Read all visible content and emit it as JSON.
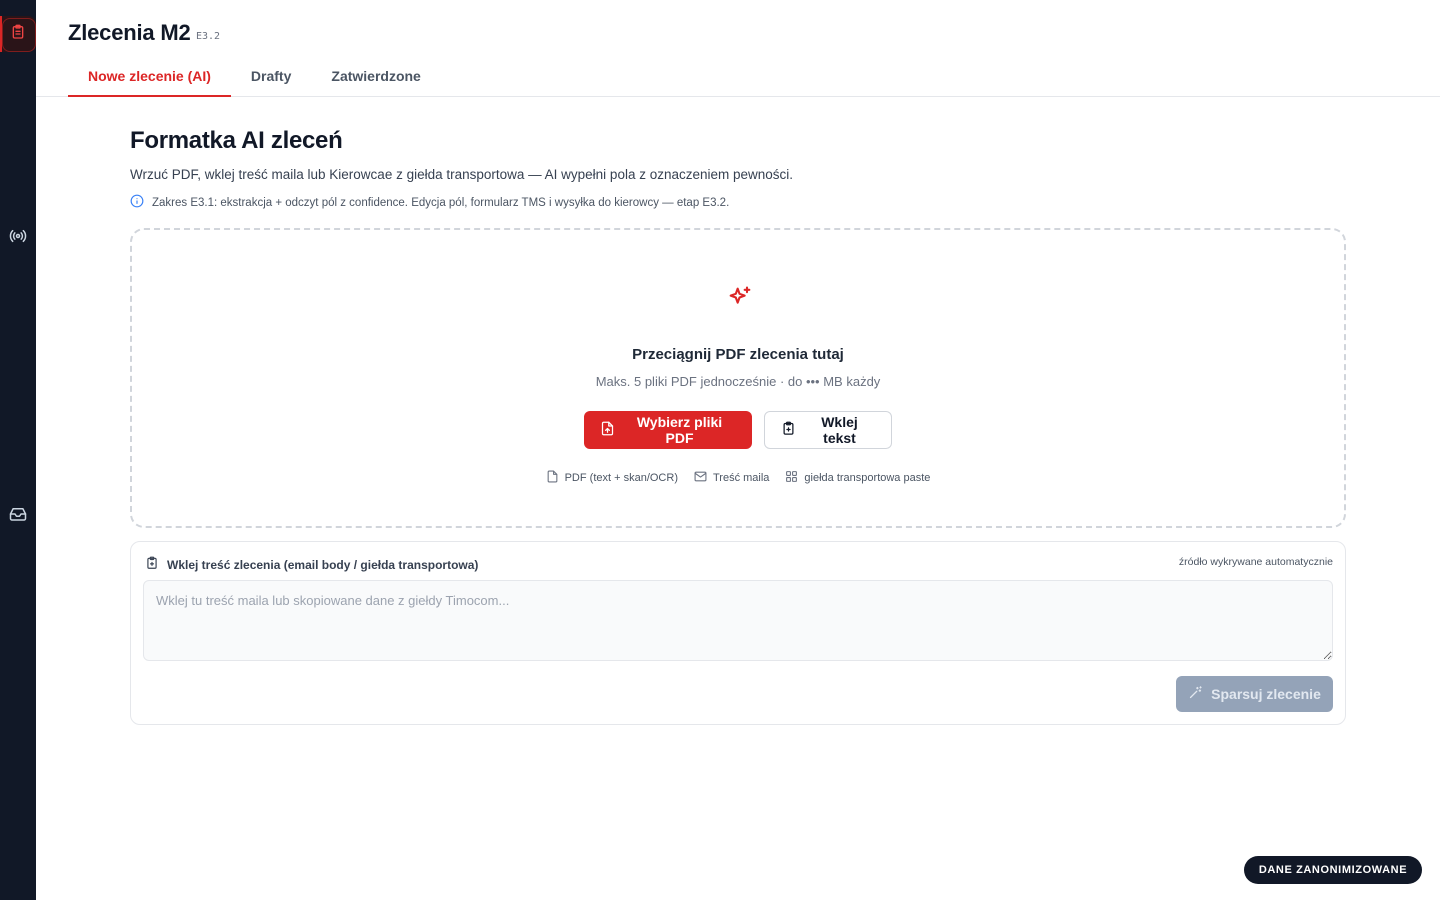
{
  "sidebar": {
    "items": [
      {
        "name": "orders",
        "icon": "clipboard-icon",
        "active": true
      },
      {
        "name": "radar",
        "icon": "radio-signal-icon",
        "active": false
      },
      {
        "name": "inbox",
        "icon": "inbox-icon",
        "active": false
      }
    ]
  },
  "header": {
    "title": "Zlecenia M2",
    "version": "E3.2",
    "tabs": [
      {
        "label": "Nowe zlecenie (AI)",
        "active": true
      },
      {
        "label": "Drafty",
        "active": false
      },
      {
        "label": "Zatwierdzone",
        "active": false
      }
    ]
  },
  "main": {
    "heading": "Formatka AI zleceń",
    "subtitle": "Wrzuć PDF, wklej treść maila lub Kierowcae z giełda transportowa — AI wypełni pola z oznaczeniem pewności.",
    "info": "Zakres E3.1: ekstrakcja + odczyt pól z confidence. Edycja pól, formularz TMS i wysyłka do kierowcy — etap E3.2."
  },
  "dropzone": {
    "title": "Przeciągnij PDF zlecenia tutaj",
    "subtitle": "Maks. 5 pliki PDF jednocześnie · do ••• MB każdy",
    "primary_button": "Wybierz pliki PDF",
    "secondary_button": "Wklej tekst",
    "chips": [
      {
        "label": "PDF (text + skan/OCR)",
        "icon": "file-icon"
      },
      {
        "label": "Treść maila",
        "icon": "mail-icon"
      },
      {
        "label": "giełda transportowa paste",
        "icon": "grid-icon"
      }
    ]
  },
  "paste": {
    "label": "Wklej treść zlecenia (email body / giełda transportowa)",
    "hint": "źródło wykrywane automatycznie",
    "placeholder": "Wklej tu treść maila lub skopiowane dane z giełdy Timocom...",
    "value": "",
    "parse_button": "Sparsuj zlecenie"
  },
  "footer": {
    "badge": "DANE ZANONIMIZOWANE"
  },
  "colors": {
    "accent": "#dc2626",
    "sidebar": "#111827",
    "disabled": "#94a3b8"
  }
}
